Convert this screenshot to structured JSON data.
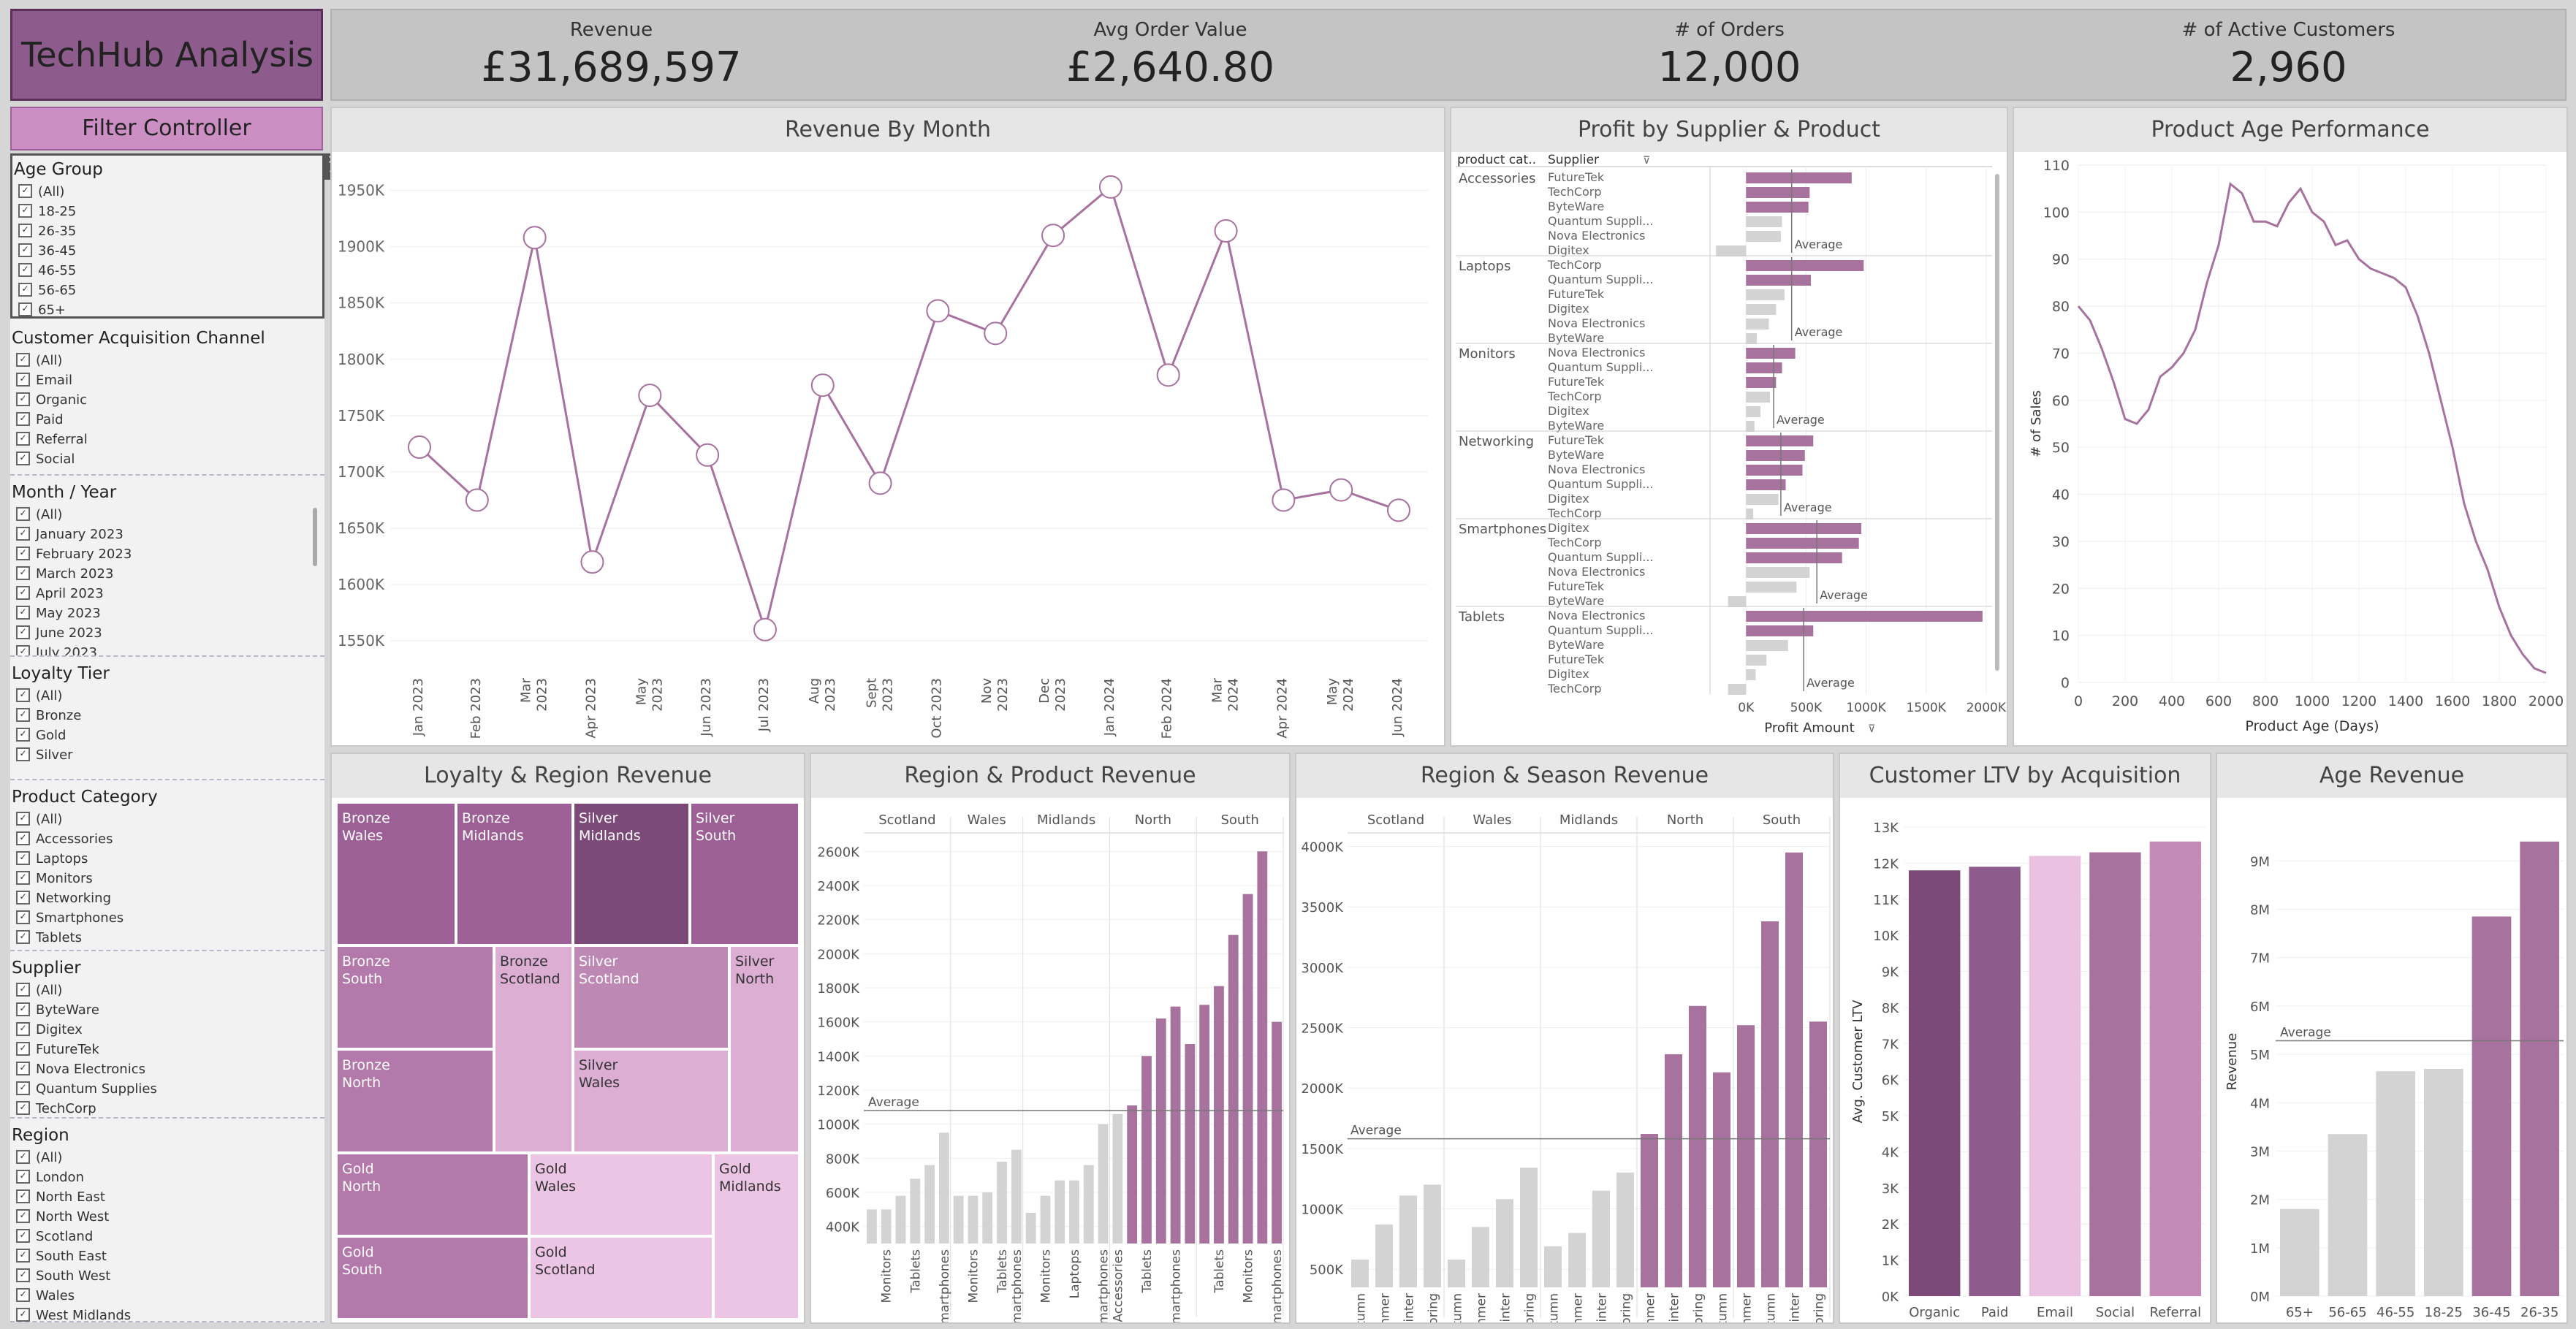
{
  "header": {
    "logo": "TechHub Analysis",
    "kpis": [
      {
        "label": "Revenue",
        "value": "£31,689,597"
      },
      {
        "label": "Avg Order Value",
        "value": "£2,640.80"
      },
      {
        "label": "# of Orders",
        "value": "12,000"
      },
      {
        "label": "# of Active Customers",
        "value": "2,960"
      }
    ]
  },
  "filters": {
    "title": "Filter Controller",
    "groups": [
      {
        "title": "Age Group",
        "items": [
          "(All)",
          "18-25",
          "26-35",
          "36-45",
          "46-55",
          "56-65",
          "65+"
        ]
      },
      {
        "title": "Customer Acquisition Channel",
        "items": [
          "(All)",
          "Email",
          "Organic",
          "Paid",
          "Referral",
          "Social"
        ]
      },
      {
        "title": "Month / Year",
        "items": [
          "(All)",
          "January 2023",
          "February 2023",
          "March 2023",
          "April 2023",
          "May 2023",
          "June 2023",
          "July 2023"
        ]
      },
      {
        "title": "Loyalty Tier",
        "items": [
          "(All)",
          "Bronze",
          "Gold",
          "Silver"
        ]
      },
      {
        "title": "Product Category",
        "items": [
          "(All)",
          "Accessories",
          "Laptops",
          "Monitors",
          "Networking",
          "Smartphones",
          "Tablets"
        ]
      },
      {
        "title": "Supplier",
        "items": [
          "(All)",
          "ByteWare",
          "Digitex",
          "FutureTek",
          "Nova Electronics",
          "Quantum Supplies",
          "TechCorp"
        ]
      },
      {
        "title": "Region",
        "items": [
          "(All)",
          "London",
          "North East",
          "North West",
          "Scotland",
          "South East",
          "South West",
          "Wales",
          "West Midlands"
        ]
      }
    ]
  },
  "colors": {
    "purple_dark": "#7b4a78",
    "purple": "#a8729f",
    "purple_mid": "#c48ab8",
    "pink_light": "#ebc1e2",
    "grey_bar": "#d3d3d3"
  },
  "charts": {
    "revenue_by_month": {
      "title": "Revenue By Month",
      "chart_data": {
        "type": "line",
        "x": [
          "Jan 2023",
          "Feb 2023",
          "Mar 2023",
          "Apr 2023",
          "May 2023",
          "Jun 2023",
          "Jul 2023",
          "Aug 2023",
          "Sept 2023",
          "Oct 2023",
          "Nov 2023",
          "Dec 2023",
          "Jan 2024",
          "Feb 2024",
          "Mar 2024",
          "Apr 2024",
          "May 2024",
          "Jun 2024"
        ],
        "values": [
          1722,
          1675,
          1908,
          1620,
          1768,
          1715,
          1560,
          1777,
          1690,
          1843,
          1823,
          1910,
          1953,
          1786,
          1914,
          1675,
          1684,
          1666
        ],
        "ylim": [
          1530,
          1975
        ],
        "yticks": [
          "1550K",
          "1600K",
          "1650K",
          "1700K",
          "1750K",
          "1800K",
          "1850K",
          "1900K",
          "1950K"
        ]
      }
    },
    "profit_supplier": {
      "title": "Profit by Supplier & Product",
      "col_category": "product cat..",
      "col_supplier": "Supplier",
      "xlabel": "Profit Amount",
      "avg_label": "Average",
      "xticks": [
        "0K",
        "500K",
        "1000K",
        "1500K",
        "2000K"
      ],
      "chart_data": {
        "type": "bar",
        "groups": [
          {
            "category": "Accessories",
            "avg": 380,
            "bars": [
              {
                "s": "FutureTek",
                "v": 880
              },
              {
                "s": "TechCorp",
                "v": 530
              },
              {
                "s": "ByteWare",
                "v": 520
              },
              {
                "s": "Quantum Suppli...",
                "v": 300
              },
              {
                "s": "Nova Electronics",
                "v": 290
              },
              {
                "s": "Digitex",
                "v": -250
              }
            ]
          },
          {
            "category": "Laptops",
            "avg": 380,
            "bars": [
              {
                "s": "TechCorp",
                "v": 980
              },
              {
                "s": "Quantum Suppli...",
                "v": 540
              },
              {
                "s": "FutureTek",
                "v": 320
              },
              {
                "s": "Digitex",
                "v": 250
              },
              {
                "s": "Nova Electronics",
                "v": 190
              },
              {
                "s": "ByteWare",
                "v": 90
              }
            ]
          },
          {
            "category": "Monitors",
            "avg": 230,
            "bars": [
              {
                "s": "Nova Electronics",
                "v": 410
              },
              {
                "s": "Quantum Suppli...",
                "v": 300
              },
              {
                "s": "FutureTek",
                "v": 250
              },
              {
                "s": "TechCorp",
                "v": 200
              },
              {
                "s": "Digitex",
                "v": 120
              },
              {
                "s": "ByteWare",
                "v": 70
              }
            ]
          },
          {
            "category": "Networking",
            "avg": 290,
            "bars": [
              {
                "s": "FutureTek",
                "v": 560
              },
              {
                "s": "ByteWare",
                "v": 490
              },
              {
                "s": "Nova Electronics",
                "v": 470
              },
              {
                "s": "Quantum Suppli...",
                "v": 330
              },
              {
                "s": "Digitex",
                "v": 270
              },
              {
                "s": "TechCorp",
                "v": 60
              }
            ]
          },
          {
            "category": "Smartphones",
            "avg": 590,
            "bars": [
              {
                "s": "Digitex",
                "v": 960
              },
              {
                "s": "TechCorp",
                "v": 940
              },
              {
                "s": "Quantum Suppli...",
                "v": 800
              },
              {
                "s": "Nova Electronics",
                "v": 530
              },
              {
                "s": "FutureTek",
                "v": 420
              },
              {
                "s": "ByteWare",
                "v": -150
              }
            ]
          },
          {
            "category": "Tablets",
            "avg": 480,
            "bars": [
              {
                "s": "Nova Electronics",
                "v": 1970
              },
              {
                "s": "Quantum Suppli...",
                "v": 560
              },
              {
                "s": "ByteWare",
                "v": 350
              },
              {
                "s": "FutureTek",
                "v": 170
              },
              {
                "s": "Digitex",
                "v": 80
              },
              {
                "s": "TechCorp",
                "v": -150
              }
            ]
          }
        ]
      }
    },
    "product_age": {
      "title": "Product Age Performance",
      "xlabel": "Product Age (Days)",
      "ylabel": "# of Sales",
      "chart_data": {
        "type": "line",
        "x": [
          0,
          50,
          100,
          150,
          200,
          250,
          300,
          350,
          400,
          450,
          500,
          550,
          600,
          650,
          700,
          750,
          800,
          850,
          900,
          950,
          1000,
          1050,
          1100,
          1150,
          1200,
          1250,
          1300,
          1350,
          1400,
          1450,
          1500,
          1550,
          1600,
          1650,
          1700,
          1750,
          1800,
          1850,
          1900,
          1950,
          2000
        ],
        "values": [
          80,
          77,
          71,
          64,
          56,
          55,
          58,
          65,
          67,
          70,
          75,
          85,
          93,
          106,
          104,
          98,
          98,
          97,
          102,
          105,
          100,
          98,
          93,
          94,
          90,
          88,
          87,
          86,
          84,
          78,
          70,
          60,
          50,
          38,
          30,
          24,
          16,
          10,
          6,
          3,
          2
        ],
        "xlim": [
          0,
          2000
        ],
        "ylim": [
          0,
          110
        ],
        "xticks": [
          "0",
          "200",
          "400",
          "600",
          "800",
          "1000",
          "1200",
          "1400",
          "1600",
          "1800",
          "2000"
        ],
        "yticks": [
          "0",
          "10",
          "20",
          "30",
          "40",
          "50",
          "60",
          "70",
          "80",
          "90",
          "100",
          "110"
        ]
      }
    },
    "loyalty_region": {
      "title": "Loyalty & Region Revenue",
      "cells": [
        {
          "label": "Bronze Wales",
          "shade": "purple"
        },
        {
          "label": "Bronze Midlands",
          "shade": "purple"
        },
        {
          "label": "Silver Midlands",
          "shade": "purple_dark"
        },
        {
          "label": "Silver South",
          "shade": "purple"
        },
        {
          "label": "Bronze South",
          "shade": "purple_mid2"
        },
        {
          "label": "Bronze Scotland",
          "shade": "pink_mid"
        },
        {
          "label": "Silver Scotland",
          "shade": "purple_mid"
        },
        {
          "label": "Silver North",
          "shade": "pink_mid"
        },
        {
          "label": "Bronze North",
          "shade": "purple_mid2"
        },
        {
          "label": "Silver Wales",
          "shade": "pink_mid"
        },
        {
          "label": "Gold North",
          "shade": "purple_mid2"
        },
        {
          "label": "Gold Wales",
          "shade": "pink_light"
        },
        {
          "label": "Gold Midlands",
          "shade": "pink_light"
        },
        {
          "label": "Gold South",
          "shade": "purple_mid2"
        },
        {
          "label": "Gold Scotland",
          "shade": "pink_light"
        }
      ]
    },
    "region_product": {
      "title": "Region & Product Revenue",
      "avg_label": "Average",
      "yticks": [
        "400K",
        "600K",
        "800K",
        "1000K",
        "1200K",
        "1400K",
        "1600K",
        "1800K",
        "2000K",
        "2200K",
        "2400K",
        "2600K"
      ],
      "chart_data": {
        "type": "bar",
        "ylim": [
          300,
          2700
        ],
        "avg": 1080,
        "regions": [
          {
            "name": "Scotland",
            "cats": [
              "",
              "Monitors",
              "",
              "Tablets",
              "",
              "Smartphones"
            ],
            "values": [
              500,
              500,
              580,
              680,
              760,
              950
            ]
          },
          {
            "name": "Wales",
            "cats": [
              "",
              "Monitors",
              "",
              "Tablets",
              "Smartphones"
            ],
            "values": [
              580,
              580,
              600,
              780,
              850
            ]
          },
          {
            "name": "Midlands",
            "cats": [
              "",
              "Monitors",
              "",
              "Laptops",
              "",
              "Smartphones"
            ],
            "values": [
              480,
              580,
              670,
              670,
              760,
              1000
            ]
          },
          {
            "name": "North",
            "cats": [
              "Accessories",
              "",
              "Tablets",
              "",
              "Smartphones",
              ""
            ],
            "values": [
              1060,
              1110,
              1400,
              1620,
              1690,
              1470
            ]
          },
          {
            "name": "South",
            "cats": [
              "",
              "Tablets",
              "",
              "Monitors",
              "",
              "Smartphones"
            ],
            "values": [
              1700,
              1810,
              2110,
              2350,
              2600,
              1600
            ]
          }
        ]
      }
    },
    "region_season": {
      "title": "Region & Season Revenue",
      "avg_label": "Average",
      "yticks": [
        "500K",
        "1000K",
        "1500K",
        "2000K",
        "2500K",
        "3000K",
        "3500K",
        "4000K"
      ],
      "chart_data": {
        "type": "bar",
        "ylim": [
          350,
          4100
        ],
        "avg": 1580,
        "seasons": [
          "Autumn",
          "Summer",
          "Winter",
          "Spring"
        ],
        "regions": [
          {
            "name": "Scotland",
            "values": [
              580,
              870,
              1110,
              1200
            ]
          },
          {
            "name": "Wales",
            "values": [
              580,
              850,
              1080,
              1340
            ]
          },
          {
            "name": "Midlands",
            "values": [
              690,
              800,
              1150,
              1300
            ]
          },
          {
            "name": "North",
            "seasons": [
              "Summer",
              "Winter",
              "Spring",
              "Autumn"
            ],
            "values": [
              1620,
              2280,
              2680,
              2130
            ]
          },
          {
            "name": "South",
            "seasons": [
              "Summer",
              "Autumn",
              "Winter",
              "Spring"
            ],
            "values": [
              2520,
              3380,
              3950,
              2550
            ]
          }
        ]
      }
    },
    "ltv": {
      "title": "Customer LTV by Acquisition",
      "ylabel": "Avg. Customer LTV",
      "yticks": [
        "0K",
        "1K",
        "2K",
        "3K",
        "4K",
        "5K",
        "6K",
        "7K",
        "8K",
        "9K",
        "10K",
        "11K",
        "12K",
        "13K"
      ],
      "chart_data": {
        "type": "bar",
        "categories": [
          "Organic",
          "Paid",
          "Email",
          "Social",
          "Referral"
        ],
        "values": [
          11.8,
          11.9,
          12.2,
          12.3,
          12.6
        ],
        "ylim": [
          0,
          13
        ]
      }
    },
    "age_revenue": {
      "title": "Age Revenue",
      "ylabel": "Revenue",
      "avg_label": "Average",
      "yticks": [
        "0M",
        "1M",
        "2M",
        "3M",
        "4M",
        "5M",
        "6M",
        "7M",
        "8M",
        "9M"
      ],
      "chart_data": {
        "type": "bar",
        "categories": [
          "65+",
          "56-65",
          "46-55",
          "18-25",
          "36-45",
          "26-35"
        ],
        "values": [
          1.8,
          3.35,
          4.65,
          4.7,
          7.85,
          9.4
        ],
        "ylim": [
          0,
          9.7
        ],
        "avg": 5.28
      }
    }
  }
}
